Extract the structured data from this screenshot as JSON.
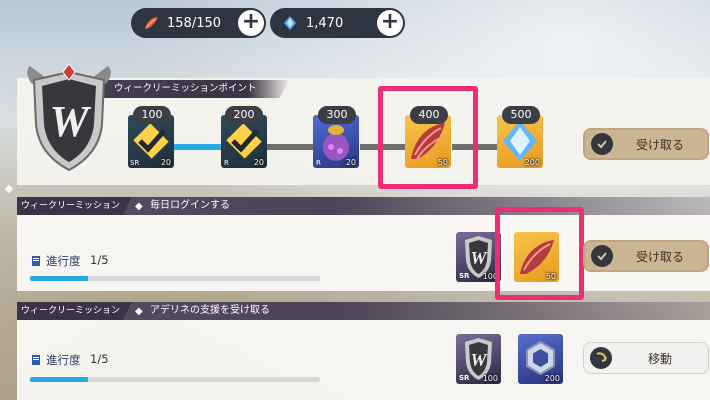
{
  "currency": {
    "wings": {
      "value": "158/150",
      "icon": "wing-icon"
    },
    "gems": {
      "value": "1,470",
      "icon": "gem-icon"
    }
  },
  "weekly": {
    "title": "ウィークリーミッションポイント",
    "claim_label": "受け取る",
    "milestones": [
      {
        "points": "100",
        "count": "20",
        "rarity": "SR"
      },
      {
        "points": "200",
        "count": "20",
        "rarity": "R"
      },
      {
        "points": "300",
        "count": "20",
        "rarity": "R"
      },
      {
        "points": "400",
        "count": "50"
      },
      {
        "points": "500",
        "count": "200"
      }
    ]
  },
  "missions": [
    {
      "tag": "ウィークリーミッション",
      "title": "毎日ログインする",
      "progress_label": "進行度",
      "progress_value": "1/5",
      "progress_fraction": 0.2,
      "rewards": [
        {
          "label": "SR",
          "count": "100"
        },
        {
          "count": "50"
        }
      ],
      "action_label": "受け取る"
    },
    {
      "tag": "ウィークリーミッション",
      "title": "アデリネの支援を受け取る",
      "progress_label": "進行度",
      "progress_value": "1/5",
      "progress_fraction": 0.2,
      "rewards": [
        {
          "label": "SR",
          "count": "100"
        },
        {
          "count": "200"
        }
      ],
      "action_label": "移動"
    }
  ],
  "colors": {
    "highlight": "#ec2f74",
    "progress": "#2aa9e8",
    "button": "#cbb592"
  }
}
